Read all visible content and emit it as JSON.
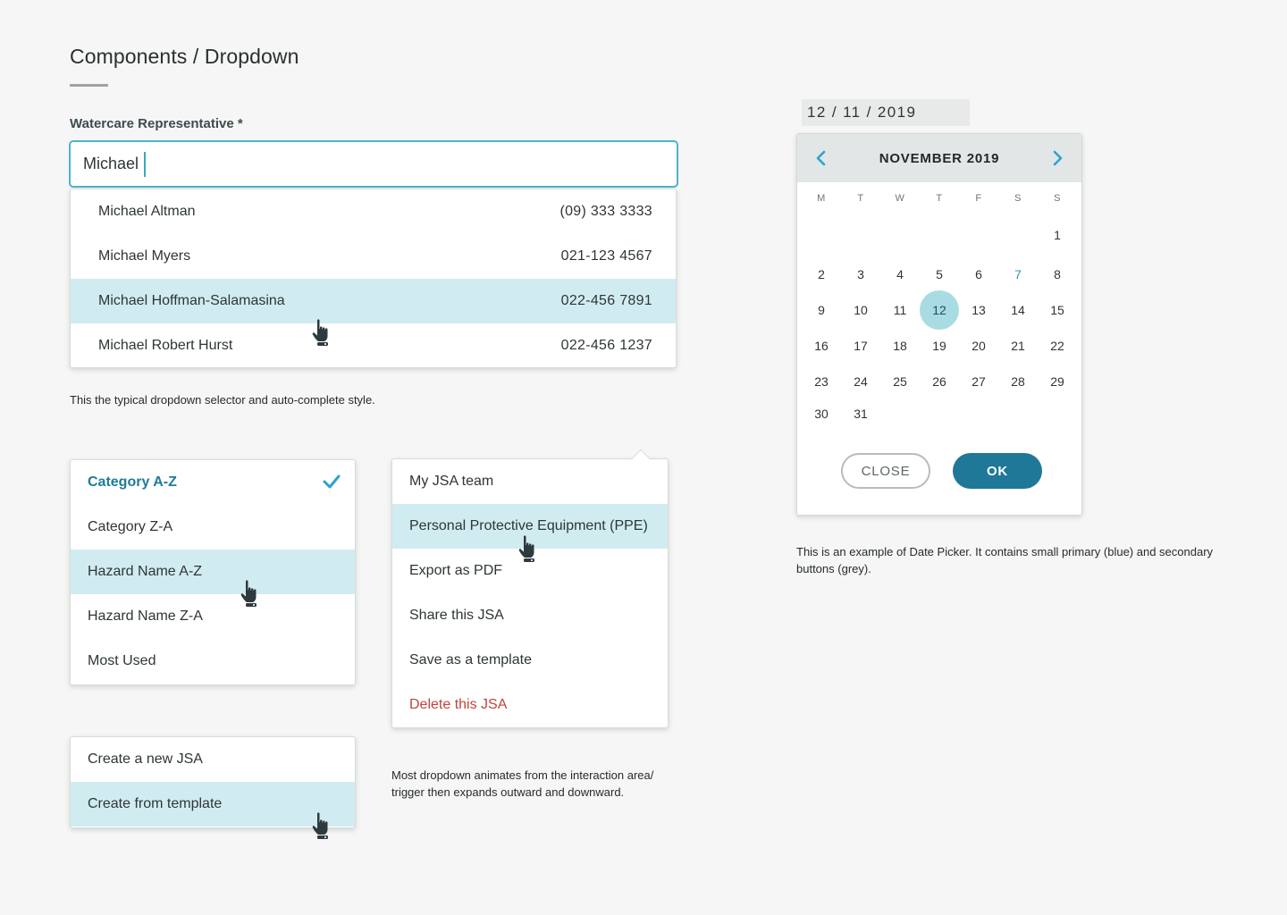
{
  "page": {
    "title": "Components / Dropdown"
  },
  "autocomplete": {
    "label": "Watercare Representative *",
    "value": "Michael",
    "results": [
      {
        "name": "Michael Altman",
        "phone": "(09) 333 3333"
      },
      {
        "name": "Michael Myers",
        "phone": "021-123 4567"
      },
      {
        "name": "Michael Hoffman-Salamasina",
        "phone": "022-456 7891"
      },
      {
        "name": "Michael Robert Hurst",
        "phone": "022-456 1237"
      }
    ],
    "note": "This the typical dropdown selector and auto-complete style."
  },
  "sort_menu": {
    "items": [
      "Category A-Z",
      "Category Z-A",
      "Hazard Name A-Z",
      "Hazard Name Z-A",
      "Most Used"
    ],
    "selected": "Category A-Z"
  },
  "jsa_menu": {
    "items": [
      "My JSA team",
      "Personal Protective Equipment (PPE)",
      "Export as PDF",
      "Share this JSA",
      "Save as a template",
      "Delete this JSA"
    ]
  },
  "create_menu": {
    "items": [
      "Create a new JSA",
      "Create from template"
    ]
  },
  "dropdown_note": {
    "line1": "Most dropdown animates from the interaction area/",
    "line2": "trigger then expands outward and downward."
  },
  "datepicker": {
    "input_value": "12 / 11 / 2019",
    "month_label": "NOVEMBER 2019",
    "weekdays": [
      "M",
      "T",
      "W",
      "T",
      "F",
      "S",
      "S"
    ],
    "days": [
      "1",
      "2",
      "3",
      "4",
      "5",
      "6",
      "7",
      "8",
      "9",
      "10",
      "11",
      "12",
      "13",
      "14",
      "15",
      "16",
      "17",
      "18",
      "19",
      "20",
      "21",
      "22",
      "23",
      "24",
      "25",
      "26",
      "27",
      "28",
      "29",
      "30",
      "31"
    ],
    "today_label": "7",
    "selected_label": "12",
    "close_label": "CLOSE",
    "ok_label": "OK",
    "note_line1": "This is an example of Date Picker. It contains small primary (blue) and secondary",
    "note_line2": "buttons (grey)."
  },
  "colors": {
    "accent": "#1f7897",
    "highlight": "#d1ecf0",
    "focus_border": "#4cb3c9",
    "danger": "#c2453a",
    "selected_day": "#a9dce2"
  },
  "icons": {
    "pointer": "hand-pointer-icon",
    "check": "check-icon",
    "prev": "chevron-left-icon",
    "next": "chevron-right-icon"
  }
}
